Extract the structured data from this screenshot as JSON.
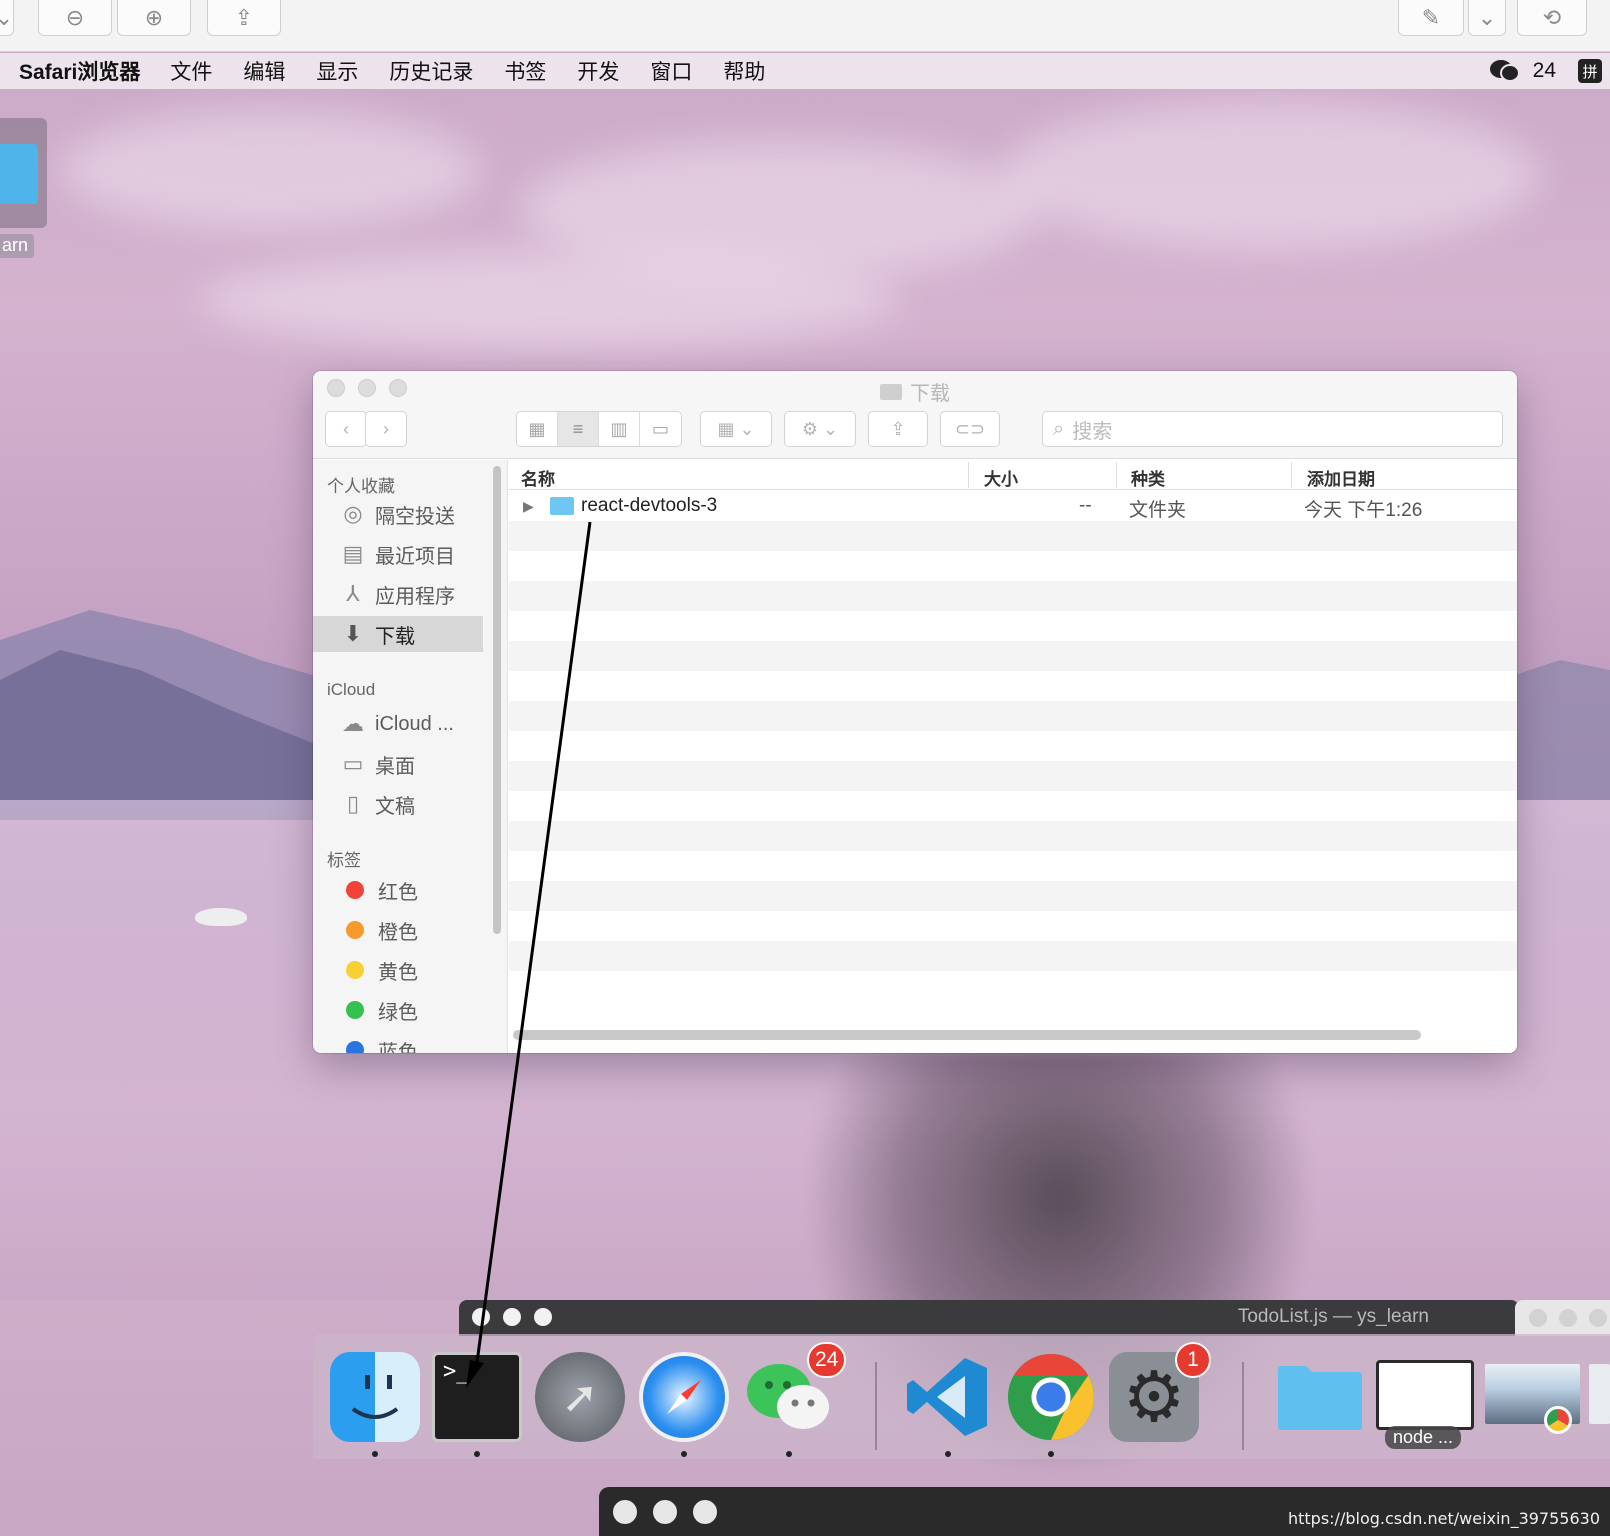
{
  "menubar": {
    "app_name": "Safari浏览器",
    "items": [
      "文件",
      "编辑",
      "显示",
      "历史记录",
      "书签",
      "开发",
      "窗口",
      "帮助"
    ],
    "wechat_count": "24",
    "ime_label": "拼"
  },
  "desktop": {
    "icon_label": "arn"
  },
  "finder": {
    "title": "下载",
    "search_placeholder": "搜索",
    "sidebar": {
      "favorites_header": "个人收藏",
      "favorites": [
        {
          "label": "隔空投送",
          "icon": "airdrop-icon"
        },
        {
          "label": "最近项目",
          "icon": "recents-icon"
        },
        {
          "label": "应用程序",
          "icon": "applications-icon"
        },
        {
          "label": "下载",
          "icon": "downloads-icon",
          "selected": true
        }
      ],
      "icloud_header": "iCloud",
      "icloud": [
        {
          "label": "iCloud ...",
          "icon": "cloud-icon"
        },
        {
          "label": "桌面",
          "icon": "desktop-icon"
        },
        {
          "label": "文稿",
          "icon": "documents-icon"
        }
      ],
      "tags_header": "标签",
      "tags": [
        {
          "label": "红色",
          "color": "#f0433a"
        },
        {
          "label": "橙色",
          "color": "#f79a2c"
        },
        {
          "label": "黄色",
          "color": "#f8cf35"
        },
        {
          "label": "绿色",
          "color": "#35c14f"
        },
        {
          "label": "蓝色",
          "color": "#2a74e0"
        }
      ]
    },
    "columns": {
      "name": "名称",
      "size": "大小",
      "kind": "种类",
      "date": "添加日期"
    },
    "files": [
      {
        "name": "react-devtools-3",
        "size": "--",
        "kind": "文件夹",
        "date": "今天 下午1:26"
      }
    ]
  },
  "background_window": {
    "title": "TodoList.js — ys_learn"
  },
  "dock": {
    "wechat_badge": "24",
    "settings_badge": "1",
    "node_label": "node ..."
  },
  "watermark": "https://blog.csdn.net/weixin_39755630"
}
